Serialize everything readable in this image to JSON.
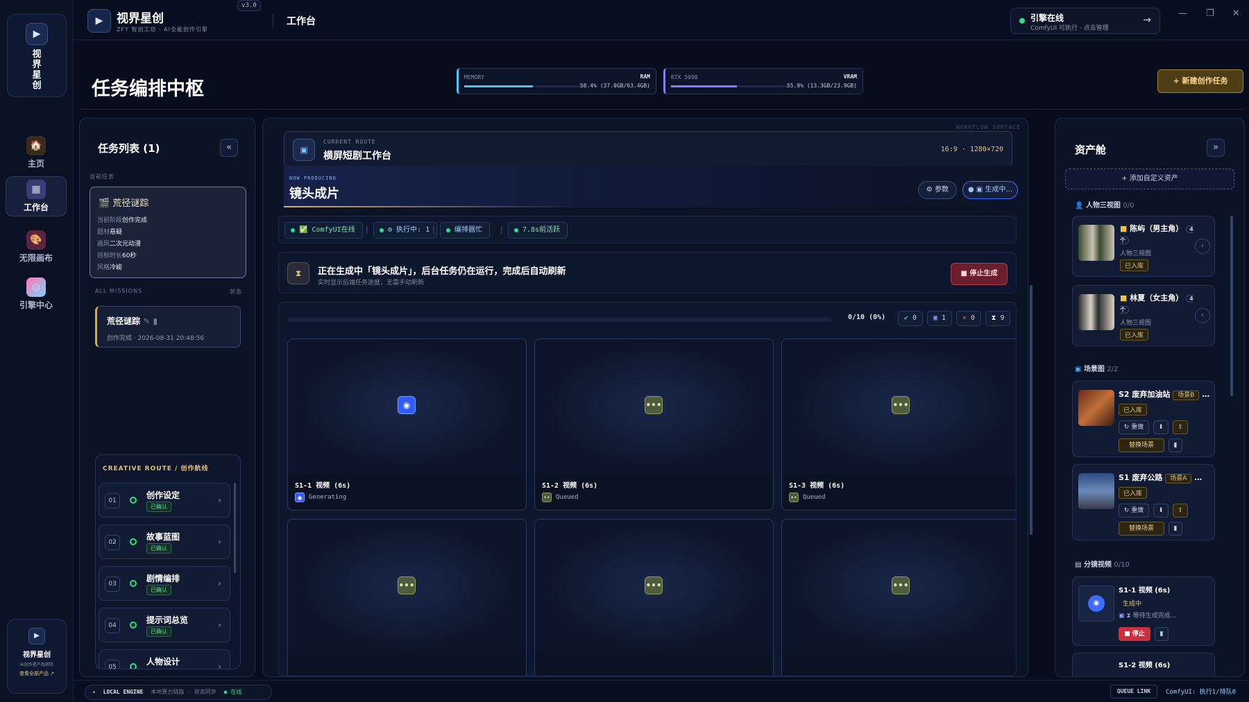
{
  "sidebar": {
    "logo_text": "视界星创",
    "nav": [
      {
        "label": "主页",
        "icon": "home-icon"
      },
      {
        "label": "工作台",
        "icon": "workbench-icon",
        "active": true
      },
      {
        "label": "无限画布",
        "icon": "palette-icon"
      },
      {
        "label": "引擎中心",
        "icon": "engine-icon"
      }
    ],
    "card": {
      "title": "视界星创",
      "subtitle": "AI创作星产品矩阵",
      "link": "查看全部产品 ↗"
    }
  },
  "topbar": {
    "app_name": "视界星创",
    "app_subtitle": "ZFY 智创工坊 · AI全能创作引擎",
    "version": "v3.0",
    "page": "工作台",
    "engine": {
      "title": "引擎在线",
      "subtitle": "ComfyUI 可执行 · 点击管理",
      "arrow": "→"
    },
    "window_controls": [
      "—",
      "❐",
      "✕"
    ]
  },
  "header": {
    "title": "任务编排中枢",
    "memory": {
      "label": "MEMORY",
      "type": "RAM",
      "value": "58.4% (37.0GB/63.4GB)",
      "percent": 58.4
    },
    "gpu": {
      "label": "RTX 5090",
      "type": "VRAM",
      "value": "55.9% (13.3GB/23.9GB)",
      "percent": 55.9
    },
    "new_task": "+ 新建创作任务"
  },
  "tasks": {
    "title": "任务列表 (1)",
    "collapse": "«",
    "current_label": "当前任务",
    "current": {
      "name": "荒径谜踪",
      "stage_k": "当前阶段",
      "stage_v": "创作完成",
      "theme_k": "题材",
      "theme_v": "悬疑",
      "style_k": "画风",
      "style_v": "二次元动漫",
      "duration_k": "目标时长",
      "duration_v": "60秒",
      "tone_k": "风格",
      "tone_v": "冷峻"
    },
    "all_label": "ALL MISSIONS",
    "status_label": "状态",
    "missions": [
      {
        "name": "荒径谜踪",
        "meta": "创作完成 · 2026-08-31 20:48:56"
      }
    ],
    "route_title": "CREATIVE ROUTE / 创作航线",
    "steps": [
      {
        "num": "01",
        "label": "创作设定",
        "status": "已确认"
      },
      {
        "num": "02",
        "label": "故事蓝图",
        "status": "已确认"
      },
      {
        "num": "03",
        "label": "剧情编排",
        "status": "已确认"
      },
      {
        "num": "04",
        "label": "提示词总览",
        "status": "已确认"
      },
      {
        "num": "05",
        "label": "人物设计",
        "status": ""
      }
    ]
  },
  "center": {
    "surface_label": "WORKFLOW SURFACE",
    "route_label": "CURRENT ROUTE",
    "route_title": "横屏短剧工作台",
    "route_spec": "16:9 · 1280×720",
    "producing_label": "NOW PRODUCING",
    "producing_title": "镜头成片",
    "params_btn": "⚙ 参数",
    "generating_btn": "生成中...",
    "chips": [
      "✅ ComfyUI在线",
      "⚙ 执行中: 1",
      "编排器忙",
      "7.8s前活跃"
    ],
    "gen_title": "正在生成中「镜头成片」，后台任务仍在运行，完成后自动刷新",
    "gen_sub": "实时显示后端任务进度，无需手动刷新",
    "stop_btn": "■ 停止生成",
    "progress_text": "0/10 (0%)",
    "progress": 0,
    "counts": [
      {
        "icon": "✔",
        "value": "0",
        "color": "#2ee08a"
      },
      {
        "icon": "▣",
        "value": "1",
        "color": "#7aa0ff"
      },
      {
        "icon": "✕",
        "value": "0",
        "color": "#ff5a6a"
      },
      {
        "icon": "⧗",
        "value": "9",
        "color": "#e6e6e6"
      }
    ],
    "shots": [
      {
        "title": "S1-1 视频 (6s)",
        "status": "Generating",
        "state": "gen"
      },
      {
        "title": "S1-2 视频 (6s)",
        "status": "Queued",
        "state": "que"
      },
      {
        "title": "S1-3 视频 (6s)",
        "status": "Queued",
        "state": "que"
      },
      {
        "title": "",
        "status": "",
        "state": "que"
      },
      {
        "title": "",
        "status": "",
        "state": "que"
      },
      {
        "title": "",
        "status": "",
        "state": "que"
      }
    ]
  },
  "assets": {
    "title": "资产舱",
    "expand": "»",
    "add": "+ 添加自定义资产",
    "char_section": "人物三视图",
    "char_count": "0/0",
    "characters": [
      {
        "name": "陈屿（男主角）",
        "count": "4个",
        "type": "人物三视图",
        "tag": "已入库"
      },
      {
        "name": "林夏（女主角）",
        "count": "4个",
        "type": "人物三视图",
        "tag": "已入库"
      }
    ],
    "scene_section": "场景图",
    "scene_count": "2/2",
    "scenes": [
      {
        "name": "S2 废弃加油站",
        "badge": "场景B",
        "tag": "已入库",
        "redo": "↻ 重做",
        "replace": "替换场景"
      },
      {
        "name": "S1 废弃公路",
        "badge": "场景A",
        "tag": "已入库",
        "redo": "↻ 重做",
        "replace": "替换场景"
      }
    ],
    "video_section": "分镜视频",
    "video_count": "0/10",
    "videos": [
      {
        "name": "S1-1 视频 (6s)",
        "status": "生成中",
        "wait": "等待生成完成...",
        "stop": "■ 停止"
      },
      {
        "name": "S1-2 视频 (6s)"
      }
    ]
  },
  "footer": {
    "engine_label": "LOCAL ENGINE",
    "engine_sub": "本地算力链路 · 状态同步",
    "online": "在线",
    "queue_link": "QUEUE LINK",
    "queue_text": "ComfyUI: 执行1/排队0"
  }
}
